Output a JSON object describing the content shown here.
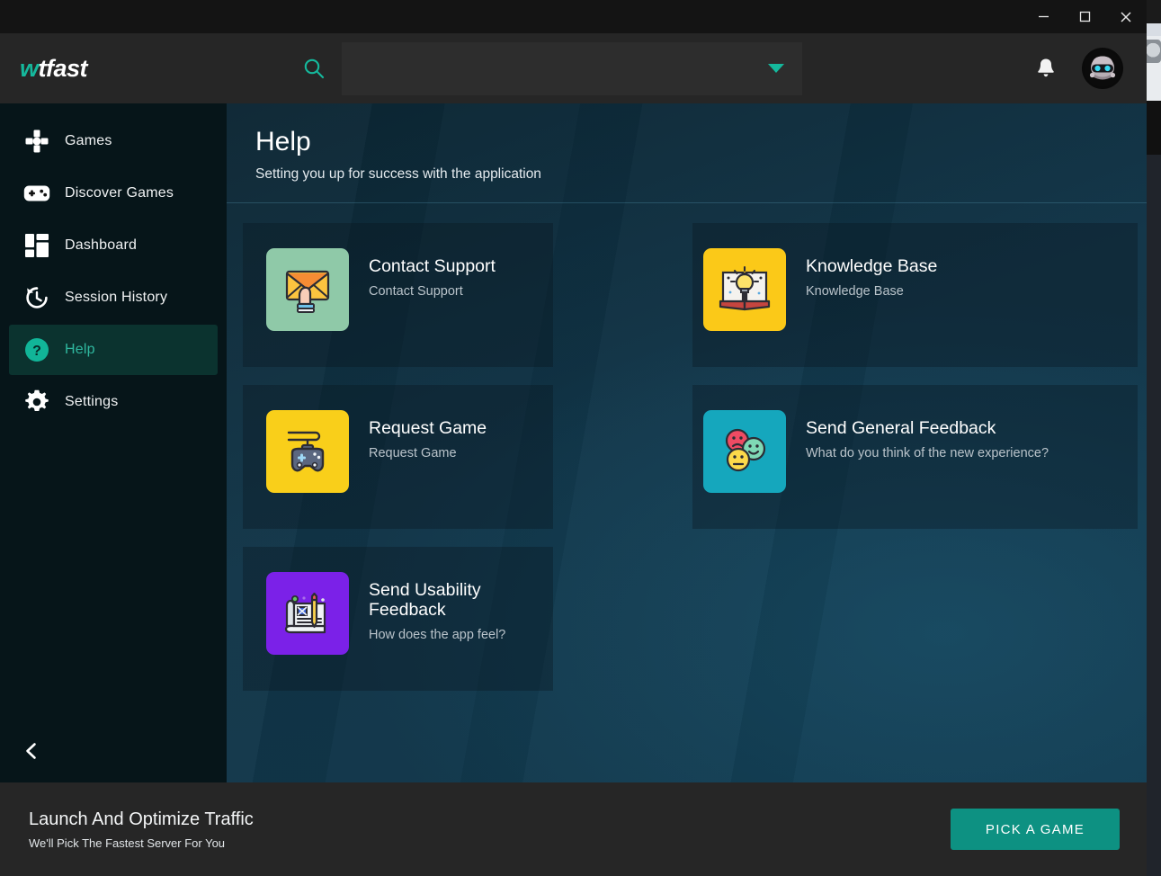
{
  "window": {
    "minimize_label": "Minimize",
    "maximize_label": "Maximize",
    "close_label": "Close"
  },
  "header": {
    "logo_w": "w",
    "logo_rest": "tfast",
    "search": {
      "value": "",
      "placeholder": ""
    },
    "notifications_label": "Notifications",
    "avatar_label": "User avatar"
  },
  "sidebar": {
    "items": [
      {
        "label": "Games",
        "icon": "dpad-icon",
        "active": false
      },
      {
        "label": "Discover Games",
        "icon": "gamepad-icon",
        "active": false
      },
      {
        "label": "Dashboard",
        "icon": "dashboard-icon",
        "active": false
      },
      {
        "label": "Session History",
        "icon": "history-icon",
        "active": false
      },
      {
        "label": "Help",
        "icon": "help-circle-icon",
        "active": true
      },
      {
        "label": "Settings",
        "icon": "gear-icon",
        "active": false
      }
    ],
    "collapse_label": "Collapse sidebar"
  },
  "page": {
    "title": "Help",
    "subtitle": "Setting you up for success with the application"
  },
  "cards": [
    {
      "title": "Contact Support",
      "desc": "Contact Support",
      "icon": "envelope-hand-icon",
      "tile_color": "#8fc9a8"
    },
    {
      "title": "Knowledge Base",
      "desc": "Knowledge Base",
      "icon": "book-lightbulb-icon",
      "tile_color": "#fbc918"
    },
    {
      "title": "Request Game",
      "desc": "Request Game",
      "icon": "gamepad-controller-icon",
      "tile_color": "#f9cf1a"
    },
    {
      "title": "Send General Feedback",
      "desc": "What do you think of the new experience?",
      "icon": "emoji-faces-icon",
      "tile_color": "#15a7bd"
    },
    {
      "title": "Send Usability Feedback",
      "desc": "How does the app feel?",
      "icon": "blueprint-pencil-icon",
      "tile_color": "#7b21e8"
    }
  ],
  "footer": {
    "title": "Launch And Optimize Traffic",
    "subtitle": "We'll Pick The Fastest Server For You",
    "cta_label": "PICK A GAME"
  },
  "colors": {
    "accent_teal": "#15b89c",
    "cta_teal": "#0d9182",
    "sidebar_bg": "#061519",
    "header_bg": "#262626",
    "content_bg": "#113548"
  }
}
